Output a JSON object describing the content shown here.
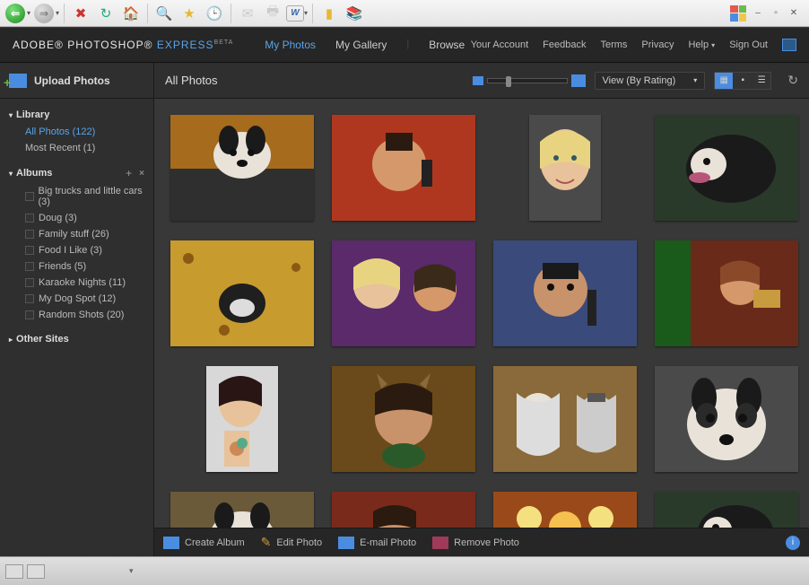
{
  "app": {
    "logo_prefix": "ADOBE® PHOTOSHOP® ",
    "logo_suffix": "EXPRESS",
    "beta": "BETA"
  },
  "main_nav": {
    "my_photos": "My Photos",
    "my_gallery": "My Gallery",
    "browse": "Browse"
  },
  "right_nav": {
    "your_account": "Your Account",
    "feedback": "Feedback",
    "terms": "Terms",
    "privacy": "Privacy",
    "help": "Help",
    "sign_out": "Sign Out"
  },
  "sidebar": {
    "upload": "Upload Photos",
    "library_hdr": "Library",
    "library": {
      "all_photos": "All Photos (122)",
      "most_recent": "Most Recent (1)"
    },
    "albums_hdr": "Albums",
    "albums": [
      "Big trucks and little cars (3)",
      "Doug (3)",
      "Family stuff (26)",
      "Food I Like (3)",
      "Friends (5)",
      "Karaoke Nights (11)",
      "My Dog Spot (12)",
      "Random Shots (20)"
    ],
    "other_sites_hdr": "Other Sites"
  },
  "content": {
    "title": "All Photos",
    "view_dropdown": "View (By Rating)"
  },
  "actions": {
    "create_album": "Create Album",
    "edit_photo": "Edit Photo",
    "email_photo": "E-mail Photo",
    "remove_photo": "Remove Photo"
  }
}
